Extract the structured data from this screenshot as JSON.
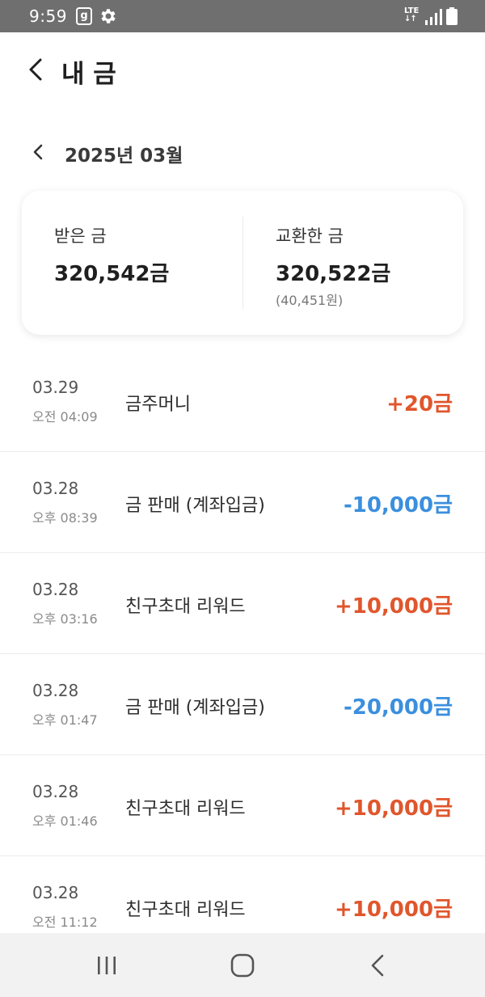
{
  "status_bar": {
    "time": "9:59",
    "app_badge": "g",
    "network": "LTE",
    "network_arrows": "↓↑",
    "icons": [
      "gear-icon",
      "signal-icon",
      "battery-icon"
    ]
  },
  "header": {
    "title": "내 금",
    "back_icon": "chevron-left-icon"
  },
  "month": {
    "label": "2025년 03월",
    "prev_icon": "chevron-left-icon"
  },
  "summary": {
    "received_label": "받은 금",
    "received_value": "320,542금",
    "exchanged_label": "교환한 금",
    "exchanged_value": "320,522금",
    "exchanged_won": "(40,451원)"
  },
  "colors": {
    "positive": "#e0562c",
    "negative": "#3b8fde"
  },
  "transactions": [
    {
      "date": "03.29",
      "time": "오전 04:09",
      "desc": "금주머니",
      "amount": "+20금",
      "type": "positive"
    },
    {
      "date": "03.28",
      "time": "오후 08:39",
      "desc": "금 판매 (계좌입금)",
      "amount": "-10,000금",
      "type": "negative"
    },
    {
      "date": "03.28",
      "time": "오후 03:16",
      "desc": "친구초대 리워드",
      "amount": "+10,000금",
      "type": "positive"
    },
    {
      "date": "03.28",
      "time": "오후 01:47",
      "desc": "금 판매 (계좌입금)",
      "amount": "-20,000금",
      "type": "negative"
    },
    {
      "date": "03.28",
      "time": "오후 01:46",
      "desc": "친구초대 리워드",
      "amount": "+10,000금",
      "type": "positive"
    },
    {
      "date": "03.28",
      "time": "오전 11:12",
      "desc": "친구초대 리워드",
      "amount": "+10,000금",
      "type": "positive"
    }
  ],
  "nav_bar": {
    "icons": [
      "recent-apps-icon",
      "home-icon",
      "back-icon"
    ]
  }
}
